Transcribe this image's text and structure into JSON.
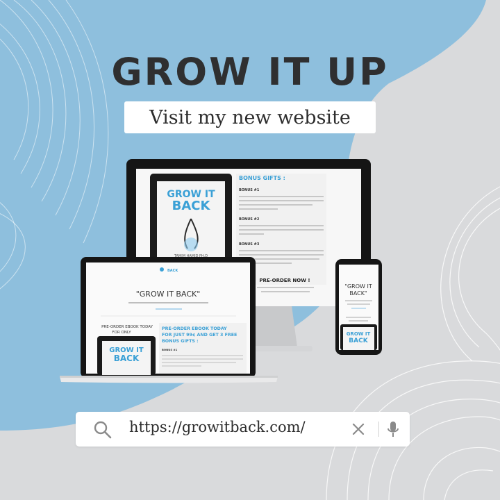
{
  "headline": "GROW IT UP",
  "subheadline": "Visit my new website",
  "search": {
    "url": "https://growitback.com/"
  },
  "icons": {
    "search": "search-icon",
    "clear": "close-icon",
    "voice": "microphone-icon"
  },
  "colors": {
    "blue_blob": "#8ebfdd",
    "background": "#d9dadc",
    "accent_blue": "#3aa0d6",
    "dark_text": "#2f2f30"
  },
  "monitor_screen": {
    "bonus_heading": "BONUS GIFTS :",
    "bonus1": "BONUS #1",
    "bonus2": "BONUS #2",
    "bonus3": "BONUS #3",
    "preorder": "PRE-ORDER NOW !",
    "book_title1": "GROW IT",
    "book_title2": "BACK",
    "book_author": "TAMIM HAMID PH.D"
  },
  "laptop_screen": {
    "page_title": "\"GROW IT BACK\"",
    "preorder_left": "PRE-ORDER EBOOK TODAY",
    "preorder_left2": "FOR ONLY",
    "preorder_headline1": "PRE-ORDER EBOOK TODAY",
    "preorder_headline2": "FOR JUST 99¢ AND GET 3 FREE",
    "preorder_headline3": "BONUS GIFTS :",
    "bonus1": "BONUS #1",
    "book_title1": "GROW IT",
    "book_title2": "BACK",
    "logo": "BACK"
  },
  "phone_screen": {
    "title1": "\"GROW IT",
    "title2": "BACK\"",
    "book_title1": "GROW IT",
    "book_title2": "BACK"
  }
}
